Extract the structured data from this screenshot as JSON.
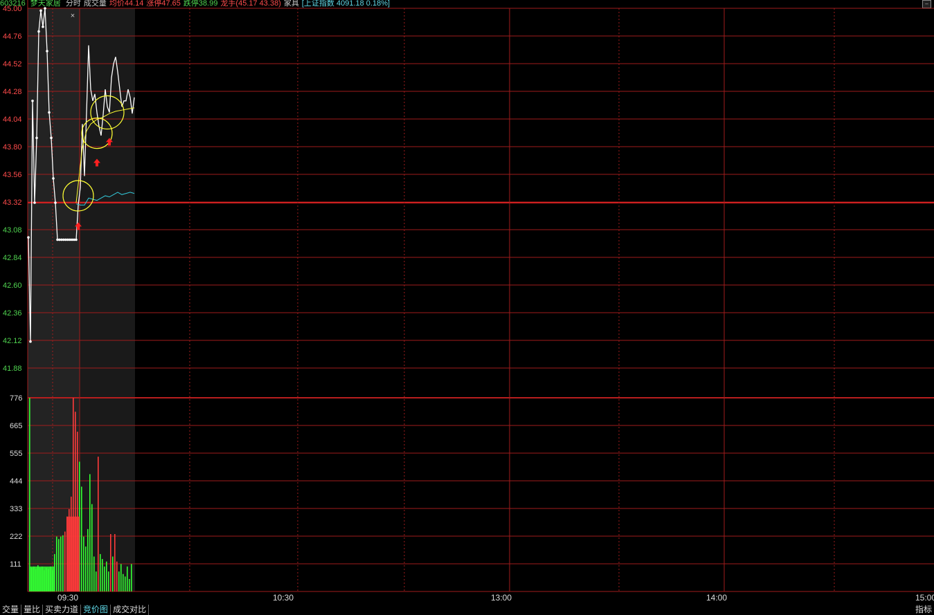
{
  "header": {
    "code": "603216",
    "name": "梦天家居",
    "items": [
      {
        "text": "分时",
        "color": "gray"
      },
      {
        "text": "成交量",
        "color": "gray"
      },
      {
        "text": "均价44.14",
        "color": "red"
      },
      {
        "text": "涨停47.65",
        "color": "red"
      },
      {
        "text": "跌停38.99",
        "color": "green"
      },
      {
        "text": "龙手(45.17 43.38)",
        "color": "red"
      },
      {
        "text": "家具",
        "color": "gray"
      },
      {
        "text": "[上证指数 4091.18 0.18%]",
        "color": "cyan"
      }
    ]
  },
  "colors": {
    "up": "#ff3b3b",
    "down": "#33ff33",
    "price": "#ffffff",
    "avg": "#ffff33",
    "index": "#33ccdd",
    "grid": "#a01c1c",
    "annotation": "#ffff33"
  },
  "chart_data": [
    {
      "type": "line",
      "title": "",
      "ylim": [
        41.64,
        45.0
      ],
      "y_ticks": [
        "45.00",
        "44.76",
        "44.52",
        "44.28",
        "44.04",
        "43.80",
        "43.56",
        "43.32",
        "43.08",
        "42.84",
        "42.60",
        "42.36",
        "42.12",
        "41.88"
      ],
      "x_ticks": [
        "09:30",
        "10:30",
        "13:00",
        "14:00",
        "15:00"
      ],
      "series": [
        {
          "key": "price",
          "x": [
            0,
            1,
            2,
            3,
            4,
            5,
            6,
            7,
            8,
            9,
            10,
            11,
            12,
            13,
            14,
            15,
            16,
            17,
            18,
            19,
            20,
            21,
            22,
            23,
            24,
            25,
            26,
            27,
            28,
            29,
            30,
            31,
            32,
            33,
            34,
            35,
            36,
            37,
            38,
            39,
            40,
            41,
            42,
            43,
            44,
            45,
            46,
            47,
            48,
            49,
            50,
            51
          ],
          "values": [
            43.02,
            42.12,
            44.2,
            43.32,
            43.88,
            44.8,
            44.98,
            44.84,
            45.0,
            44.63,
            44.1,
            43.88,
            43.53,
            43.32,
            43.0,
            43.0,
            43.0,
            43.0,
            43.0,
            43.0,
            43.0,
            43.0,
            43.0,
            43.0,
            43.3,
            43.45,
            44.0,
            43.55,
            44.1,
            44.68,
            44.3,
            44.2,
            44.26,
            44.1,
            43.98,
            43.9,
            44.08,
            44.3,
            44.15,
            44.1,
            44.4,
            44.52,
            44.58,
            44.45,
            44.3,
            44.15,
            44.2,
            44.2,
            44.3,
            44.23,
            44.09,
            44.23
          ]
        },
        {
          "key": "avg",
          "x": [
            23,
            26,
            28,
            30,
            33,
            36,
            39,
            42,
            45,
            48,
            51
          ],
          "values": [
            43.32,
            43.8,
            43.94,
            44.0,
            44.04,
            44.06,
            44.09,
            44.11,
            44.12,
            44.13,
            44.14
          ]
        },
        {
          "key": "index",
          "x": [
            23,
            25,
            27,
            29,
            31,
            33,
            35,
            37,
            39,
            41,
            43,
            45,
            47,
            49,
            51
          ],
          "values": [
            43.31,
            43.3,
            43.3,
            43.36,
            43.35,
            43.34,
            43.36,
            43.38,
            43.37,
            43.39,
            43.41,
            43.39,
            43.4,
            43.41,
            43.4
          ]
        }
      ]
    },
    {
      "type": "bar",
      "title": "",
      "ylim": [
        0,
        776
      ],
      "y_ticks": [
        "776",
        "665",
        "555",
        "444",
        "333",
        "222",
        "111"
      ],
      "bars": [
        [
          2,
          776,
          "down"
        ],
        [
          3,
          95,
          "down"
        ],
        [
          4,
          100,
          "down"
        ],
        [
          5,
          90,
          "down"
        ],
        [
          6,
          105,
          "down"
        ],
        [
          7,
          95,
          "down"
        ],
        [
          8,
          100,
          "down"
        ],
        [
          9,
          85,
          "down"
        ],
        [
          10,
          95,
          "down"
        ],
        [
          11,
          90,
          "down"
        ],
        [
          12,
          100,
          "down"
        ],
        [
          13,
          85,
          "down"
        ],
        [
          14,
          150,
          "down"
        ],
        [
          15,
          220,
          "down"
        ],
        [
          16,
          210,
          "down"
        ],
        [
          17,
          220,
          "down"
        ],
        [
          18,
          225,
          "down"
        ],
        [
          19,
          240,
          "up"
        ],
        [
          20,
          300,
          "up"
        ],
        [
          21,
          330,
          "up"
        ],
        [
          22,
          380,
          "up"
        ],
        [
          23,
          776,
          "up"
        ],
        [
          24,
          720,
          "up"
        ],
        [
          25,
          640,
          "up"
        ],
        [
          26,
          520,
          "down"
        ],
        [
          27,
          420,
          "down"
        ],
        [
          28,
          220,
          "down"
        ],
        [
          29,
          180,
          "down"
        ],
        [
          30,
          250,
          "down"
        ],
        [
          31,
          470,
          "down"
        ],
        [
          32,
          350,
          "down"
        ],
        [
          33,
          140,
          "down"
        ],
        [
          34,
          80,
          "down"
        ],
        [
          35,
          540,
          "up"
        ],
        [
          36,
          150,
          "down"
        ],
        [
          37,
          130,
          "down"
        ],
        [
          38,
          100,
          "down"
        ],
        [
          39,
          120,
          "down"
        ],
        [
          40,
          80,
          "down"
        ],
        [
          41,
          230,
          "up"
        ],
        [
          42,
          140,
          "down"
        ],
        [
          43,
          230,
          "up"
        ],
        [
          44,
          120,
          "up"
        ],
        [
          45,
          80,
          "down"
        ],
        [
          46,
          110,
          "down"
        ],
        [
          47,
          70,
          "down"
        ],
        [
          48,
          60,
          "down"
        ],
        [
          49,
          100,
          "down"
        ],
        [
          50,
          50,
          "down"
        ],
        [
          51,
          110,
          "down"
        ]
      ]
    }
  ],
  "markers": {
    "circles": [
      [
        24,
        43.38
      ],
      [
        33,
        43.92
      ],
      [
        38,
        44.1
      ]
    ],
    "arrows": [
      [
        24,
        43.15
      ],
      [
        33,
        43.7
      ],
      [
        39,
        43.88
      ]
    ]
  },
  "footer": {
    "tabs": [
      {
        "label": "交量",
        "active": false
      },
      {
        "label": "量比",
        "active": false
      },
      {
        "label": "买卖力道",
        "active": false
      },
      {
        "label": "竞价图",
        "active": true
      },
      {
        "label": "成交对比",
        "active": false
      }
    ],
    "right_label": "指标"
  }
}
